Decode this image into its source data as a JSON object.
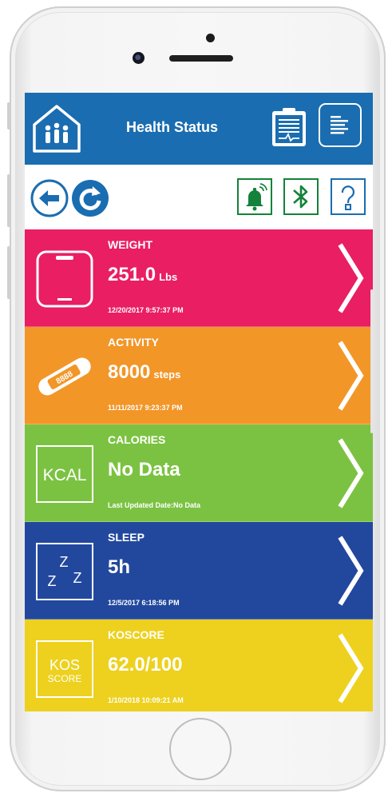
{
  "header": {
    "title": "Health Status",
    "accent_color": "#1a6db0",
    "home_icon": "family-home-icon",
    "report_icon": "clipboard-report-icon",
    "menu_icon": "list-menu-icon"
  },
  "toolbar": {
    "back_icon": "arrow-left-icon",
    "refresh_icon": "refresh-icon",
    "alerts_icon": "bell-icon",
    "bluetooth_icon": "bluetooth-icon",
    "help_icon": "question-icon"
  },
  "metrics": [
    {
      "title": "WEIGHT",
      "value": "251.0",
      "unit": "Lbs",
      "date": "12/20/2017 9:57:37 PM",
      "color": "#e91e63",
      "icon": "scale-icon"
    },
    {
      "title": "ACTIVITY",
      "value": "8000",
      "unit": "steps",
      "date": "11/11/2017 9:23:37 PM",
      "color": "#f29628",
      "icon": "fitness-band-icon"
    },
    {
      "title": "CALORIES",
      "value": "No Data",
      "unit": "",
      "date": "Last Updated  Date:No Data",
      "color": "#7cc242",
      "icon": "kcal-icon",
      "icon_text": "KCAL"
    },
    {
      "title": "SLEEP",
      "value": "5h",
      "unit": "",
      "date": "12/5/2017 6:18:56 PM",
      "color": "#22489e",
      "icon": "sleep-zzz-icon",
      "icon_text": "Z"
    },
    {
      "title": "KOSCORE",
      "value": "62.0/100",
      "unit": "",
      "date": "1/10/2018 10:09:21 AM",
      "color": "#edd11e",
      "icon": "koscore-icon",
      "icon_text_top": "KOS",
      "icon_text_bottom": "SCORE"
    }
  ]
}
